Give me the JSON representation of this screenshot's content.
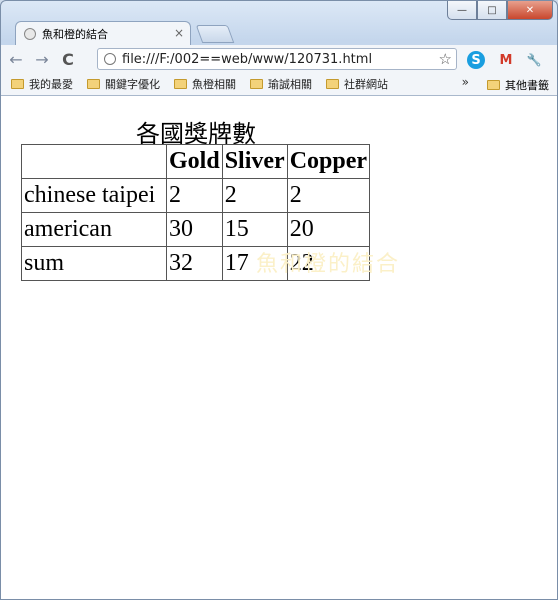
{
  "window": {
    "tab_title": "魚和橙的結合",
    "tab_close": "×",
    "controls": {
      "minimize": "—",
      "maximize": "□",
      "close": "✕"
    }
  },
  "toolbar": {
    "back": "←",
    "forward": "→",
    "reload": "C",
    "url": "file:///F:/002==web/www/120731.html",
    "star": "☆",
    "extensions": [
      {
        "name": "skype-icon",
        "glyph": "S",
        "color": "#1a9ee0"
      },
      {
        "name": "gmail-icon",
        "glyph": "M",
        "color": "#d23a2a"
      },
      {
        "name": "wrench-icon",
        "glyph": "🔧",
        "color": "#333333"
      }
    ]
  },
  "bookmarks": {
    "items": [
      "我的最愛",
      "關鍵字優化",
      "魚橙相關",
      "瑜誠相關",
      "社群網站"
    ],
    "more": "»",
    "other": "其他書籤"
  },
  "page": {
    "caption": "各國獎牌數",
    "watermark": "魚和橙的結合",
    "table": {
      "headers": [
        "",
        "Gold",
        "Sliver",
        "Copper"
      ],
      "rows": [
        [
          "chinese taipei",
          "2",
          "2",
          "2"
        ],
        [
          "american",
          "30",
          "15",
          "20"
        ],
        [
          "sum",
          "32",
          "17",
          "22"
        ]
      ]
    }
  }
}
